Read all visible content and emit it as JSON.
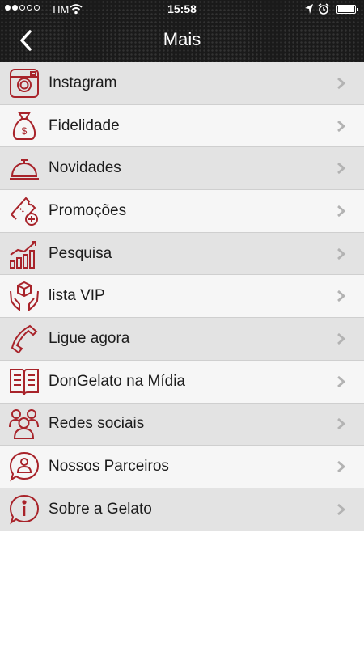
{
  "status_bar": {
    "carrier": "TIM",
    "time": "15:58",
    "signal_bars_filled": 2,
    "signal_bars_total": 5,
    "battery_level": 1.0
  },
  "nav": {
    "title": "Mais",
    "back_icon": "chevron-left-icon"
  },
  "colors": {
    "accent": "#a8232a",
    "header_bg": "#1a1a1a",
    "row_odd": "#e3e3e3",
    "row_even": "#f6f6f6"
  },
  "menu": {
    "items": [
      {
        "label": "Instagram",
        "icon": "instagram-icon"
      },
      {
        "label": "Fidelidade",
        "icon": "money-bag-icon"
      },
      {
        "label": "Novidades",
        "icon": "cloche-icon"
      },
      {
        "label": "Promoções",
        "icon": "ticket-plus-icon"
      },
      {
        "label": "Pesquisa",
        "icon": "growth-chart-icon"
      },
      {
        "label": "lista VIP",
        "icon": "hands-box-icon"
      },
      {
        "label": "Ligue agora",
        "icon": "phone-icon"
      },
      {
        "label": "DonGelato na Mídia",
        "icon": "open-book-icon"
      },
      {
        "label": "Redes sociais",
        "icon": "people-group-icon"
      },
      {
        "label": "Nossos Parceiros",
        "icon": "person-bubble-icon"
      },
      {
        "label": "Sobre a Gelato",
        "icon": "info-bubble-icon"
      }
    ]
  }
}
